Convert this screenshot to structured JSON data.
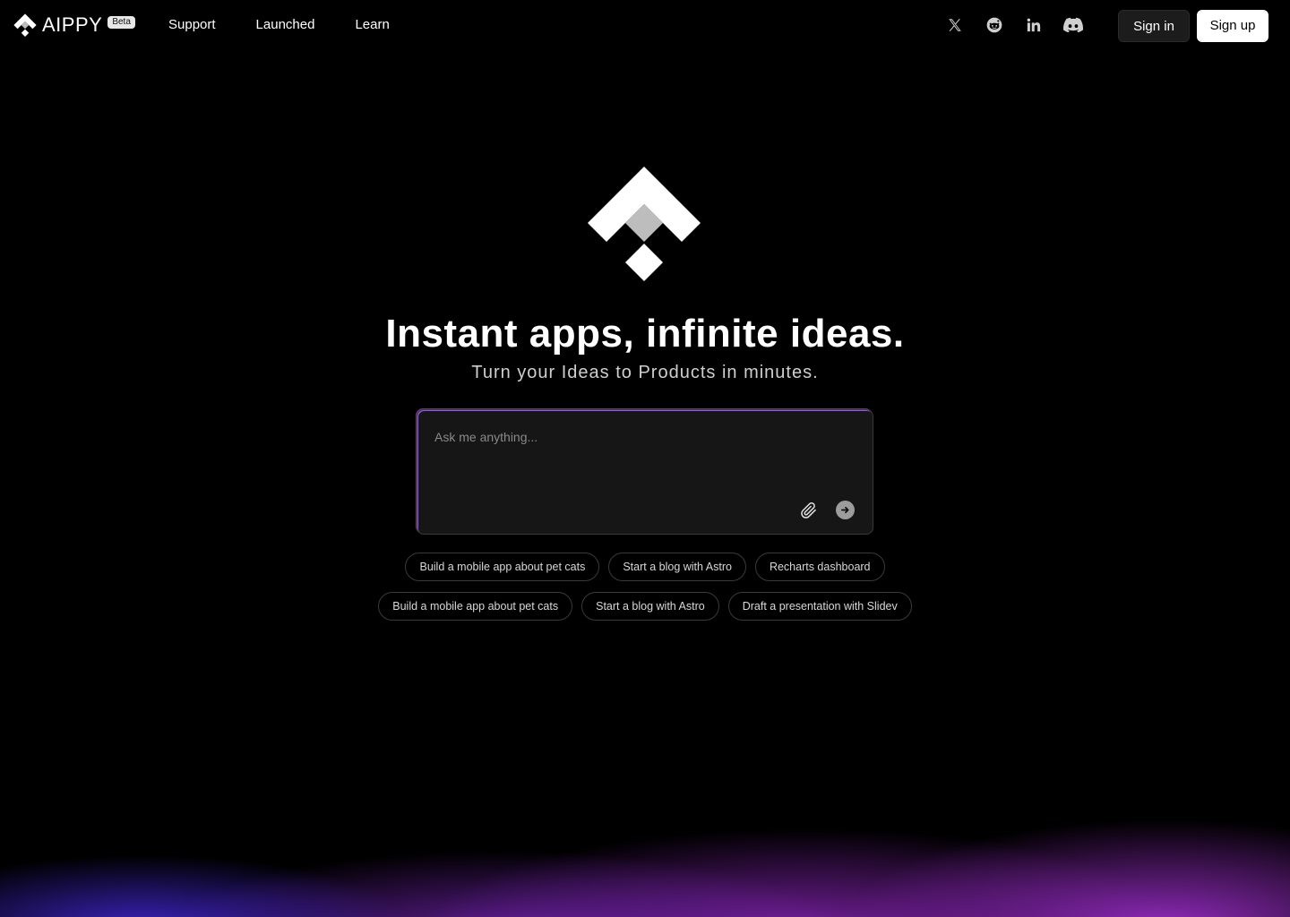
{
  "header": {
    "brand_name": "AIPPY",
    "beta_label": "Beta",
    "nav": [
      {
        "label": "Support"
      },
      {
        "label": "Launched"
      },
      {
        "label": "Learn"
      }
    ],
    "social_icons": [
      "x-icon",
      "reddit-icon",
      "linkedin-icon",
      "discord-icon"
    ],
    "sign_in_label": "Sign in",
    "sign_up_label": "Sign up"
  },
  "hero": {
    "title": "Instant apps, infinite ideas.",
    "subtitle": "Turn your Ideas to Products in minutes."
  },
  "prompt": {
    "placeholder": "Ask me anything...",
    "value": "",
    "attach_icon": "paperclip-icon",
    "send_icon": "arrow-right-icon"
  },
  "suggestions": {
    "row1": [
      {
        "label": "Build a mobile app about pet cats"
      },
      {
        "label": "Start a blog with Astro"
      },
      {
        "label": "Recharts dashboard"
      }
    ],
    "row2": [
      {
        "label": "Build a mobile app about pet cats"
      },
      {
        "label": "Start a blog with Astro"
      },
      {
        "label": "Draft a presentation with Slidev"
      }
    ]
  },
  "colors": {
    "background": "#000000",
    "prompt_bg": "#161616",
    "glow_blue": "#4628dc",
    "glow_purple": "#aa32dc"
  }
}
